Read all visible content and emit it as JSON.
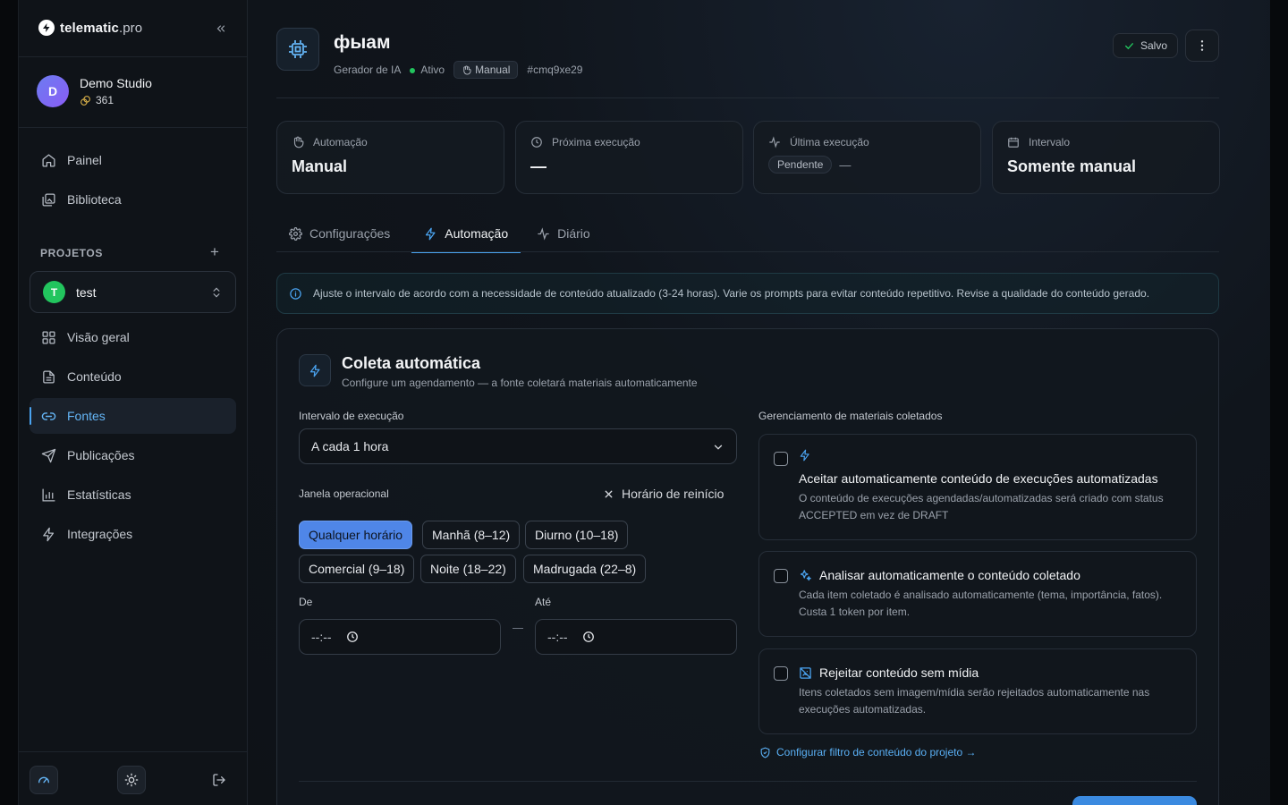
{
  "brand": {
    "name": "telematic",
    "suffix": ".pro"
  },
  "workspace": {
    "avatar_letter": "D",
    "name": "Demo Studio",
    "tokens": "361"
  },
  "nav_main": [
    {
      "label": "Painel",
      "icon": "home-icon"
    },
    {
      "label": "Biblioteca",
      "icon": "image-library-icon"
    }
  ],
  "projects": {
    "section_label": "PROJETOS",
    "add_label": "+",
    "current": {
      "letter": "T",
      "name": "test",
      "color": "#22c55e"
    }
  },
  "nav_project": [
    {
      "label": "Visão geral",
      "icon": "grid-icon",
      "active": false
    },
    {
      "label": "Conteúdo",
      "icon": "document-icon",
      "active": false
    },
    {
      "label": "Fontes",
      "icon": "link-icon",
      "active": true
    },
    {
      "label": "Publicações",
      "icon": "send-icon",
      "active": false
    },
    {
      "label": "Estatísticas",
      "icon": "bar-chart-icon",
      "active": false
    },
    {
      "label": "Integrações",
      "icon": "bolt-icon",
      "active": false
    }
  ],
  "header": {
    "title": "фыам",
    "type": "Gerador de IA",
    "status": "Ativo",
    "mode_badge": "Manual",
    "id": "#cmq9xe29",
    "saved_label": "Salvo"
  },
  "stats": [
    {
      "label": "Automação",
      "value": "Manual",
      "icon": "hand-icon"
    },
    {
      "label": "Próxima execução",
      "value": "—",
      "icon": "clock-icon"
    },
    {
      "label": "Última execução",
      "pill": "Pendente",
      "after": "—",
      "icon": "activity-icon"
    },
    {
      "label": "Intervalo",
      "value": "Somente manual",
      "icon": "calendar-icon"
    }
  ],
  "tabs": [
    {
      "label": "Configurações",
      "icon": "gear-icon",
      "active": false
    },
    {
      "label": "Automação",
      "icon": "bolt-icon",
      "active": true
    },
    {
      "label": "Diário",
      "icon": "activity-icon",
      "active": false
    }
  ],
  "info": "Ajuste o intervalo de acordo com a necessidade de conteúdo atualizado (3-24 horas). Varie os prompts para evitar conteúdo repetitivo. Revise a qualidade do conteúdo gerado.",
  "panel": {
    "title": "Coleta automática",
    "subtitle": "Configure um agendamento — a fonte coletará materiais automaticamente",
    "interval_label": "Intervalo de execução",
    "interval_value": "A cada 1 hora",
    "window_label": "Janela operacional",
    "reset_label": "Horário de reinício",
    "chips": [
      {
        "label": "Qualquer horário",
        "active": true
      },
      {
        "label": "Manhã (8–12)",
        "active": false
      },
      {
        "label": "Diurno (10–18)",
        "active": false
      },
      {
        "label": "Comercial (9–18)",
        "active": false
      },
      {
        "label": "Noite (18–22)",
        "active": false
      },
      {
        "label": "Madrugada (22–8)",
        "active": false
      }
    ],
    "from_label": "De",
    "to_label": "Até",
    "time_placeholder": "--:--",
    "manage_label": "Gerenciamento de materiais coletados",
    "options": [
      {
        "title": "Aceitar automaticamente conteúdo de execuções automatizadas",
        "desc": "O conteúdo de execuções agendadas/automatizadas será criado com status ACCEPTED em vez de DRAFT",
        "icon": "bolt-icon"
      },
      {
        "title": "Analisar automaticamente o conteúdo coletado",
        "desc": "Cada item coletado é analisado automaticamente (tema, importância, fatos). Custa 1 token por item.",
        "icon": "sparkles-icon"
      },
      {
        "title": "Rejeitar conteúdo sem mídia",
        "desc": "Itens coletados sem imagem/mídia serão rejeitados automaticamente nas execuções automatizadas.",
        "icon": "image-off-icon"
      }
    ],
    "filter_link": "Configurar filtro de conteúdo do projeto →"
  },
  "colors": {
    "accent": "#4aa3f0",
    "chip_active": "#4f86e8",
    "success": "#22c55e"
  }
}
